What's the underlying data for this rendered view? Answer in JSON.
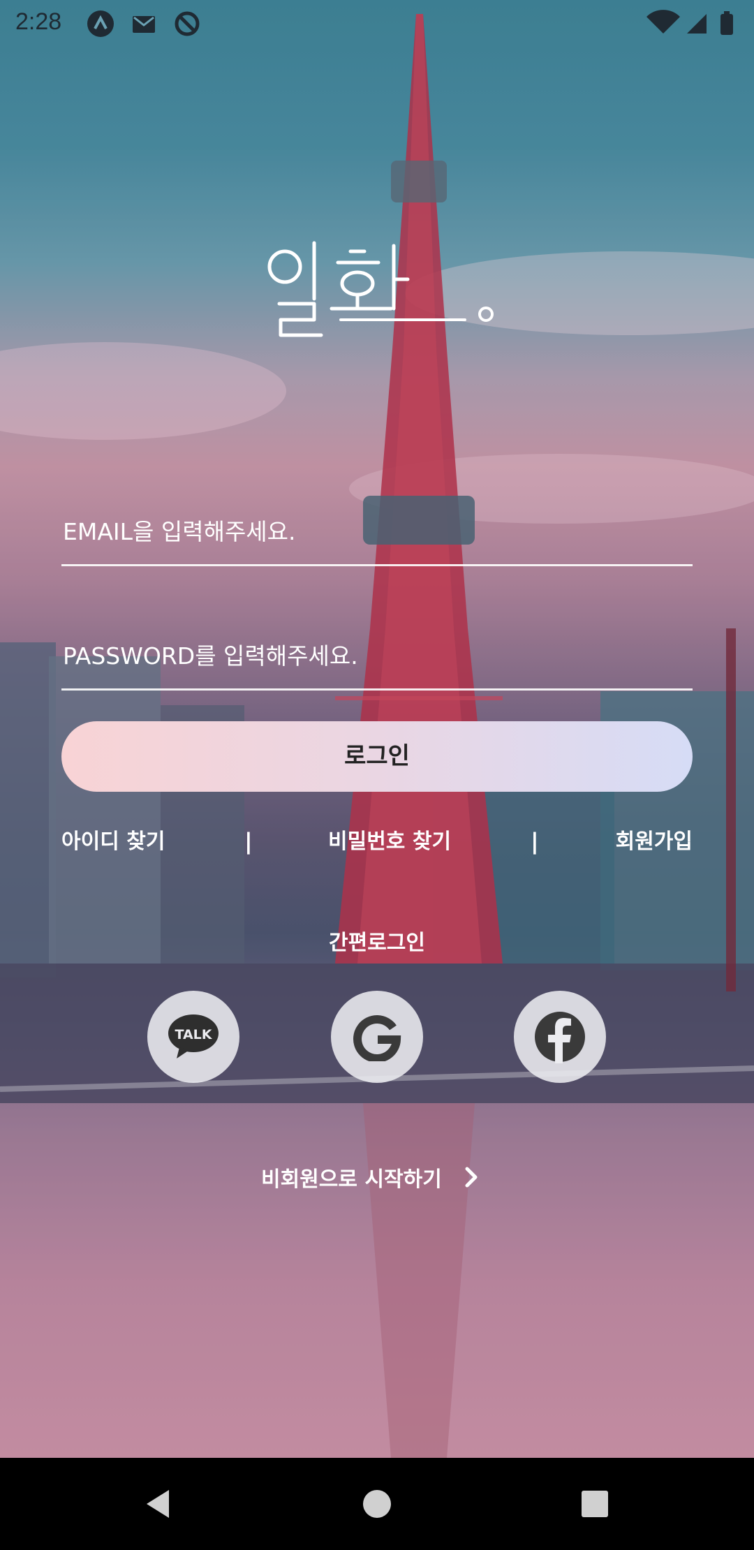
{
  "status_bar": {
    "time": "2:28",
    "left_icons": [
      "app-a-icon",
      "gmail-icon",
      "sync-icon"
    ],
    "right_icons": [
      "wifi-icon",
      "signal-icon",
      "battery-icon"
    ]
  },
  "logo": {
    "text": "일화."
  },
  "login_form": {
    "email_placeholder": "EMAIL을 입력해주세요.",
    "password_placeholder": "PASSWORD를 입력해주세요.",
    "login_button_label": "로그인"
  },
  "links": {
    "find_id": "아이디 찾기",
    "separator": "|",
    "find_password": "비밀번호 찾기",
    "signup": "회원가입"
  },
  "easy_login": {
    "label": "간편로그인",
    "providers": [
      {
        "name": "kakao",
        "icon": "kakaotalk-icon",
        "text": "TALK"
      },
      {
        "name": "google",
        "icon": "google-icon"
      },
      {
        "name": "facebook",
        "icon": "facebook-icon"
      }
    ]
  },
  "guest": {
    "label": "비회원으로 시작하기",
    "icon": "chevron-right-icon"
  },
  "nav_bar": {
    "buttons": [
      "back-icon",
      "home-icon",
      "recent-apps-icon"
    ]
  },
  "colors": {
    "login_button_start": "#f8d3d5",
    "login_button_end": "#d6dcf6",
    "social_bg": "#ececf0",
    "text_on_bg": "#ffffff"
  }
}
